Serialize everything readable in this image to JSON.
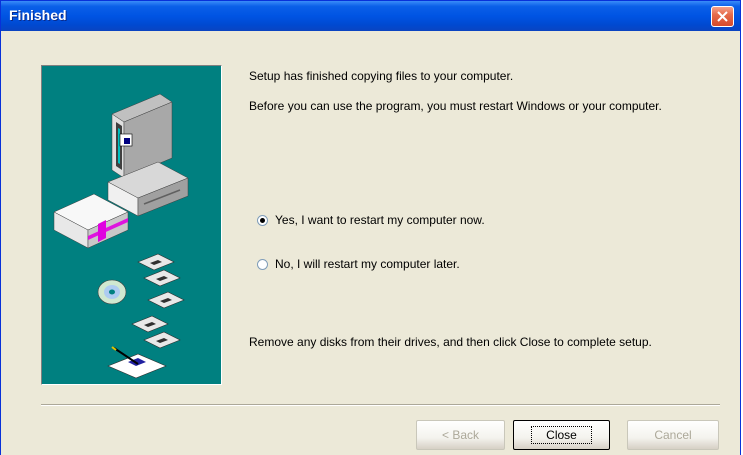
{
  "window": {
    "title": "Finished",
    "close_glyph": "✕"
  },
  "body": {
    "line1": "Setup has finished copying files to your computer.",
    "line2": "Before you can use the program, you must restart Windows or your computer.",
    "option_yes": "Yes, I want to restart my computer now.",
    "option_no": "No, I will restart my computer later.",
    "footer_instruction": "Remove any disks from their drives, and then click Close to complete setup."
  },
  "radio": {
    "selected": "yes"
  },
  "buttons": {
    "back": "< Back",
    "close": "Close",
    "cancel": "Cancel"
  },
  "colors": {
    "illustration_background": "#008080",
    "title_bar": "#0054e3",
    "dialog_background": "#ece9d8"
  }
}
